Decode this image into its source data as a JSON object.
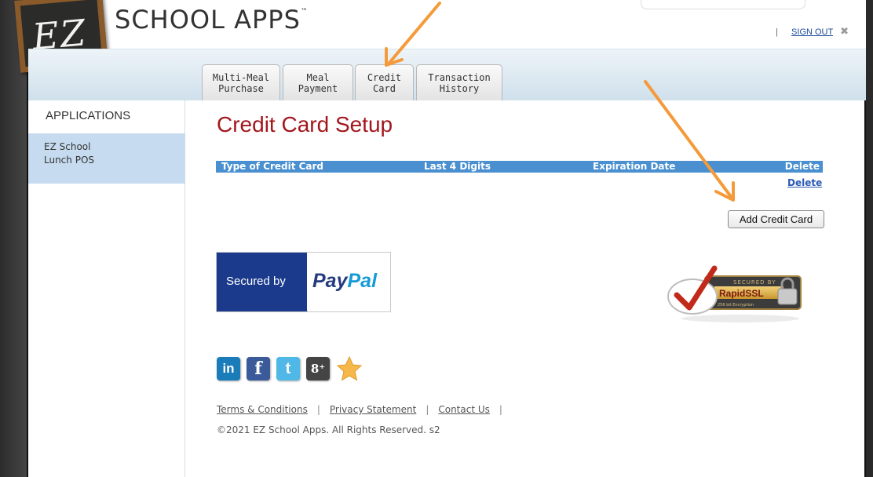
{
  "brand": {
    "logo_text": "EZ",
    "name": "SCHOOL APPS",
    "trademark": "™"
  },
  "header": {
    "separator": "|",
    "sign_out": "SIGN OUT",
    "close_symbol": "✖"
  },
  "tabs": [
    {
      "line1": "Multi-Meal",
      "line2": "Purchase"
    },
    {
      "line1": "Meal",
      "line2": "Payment"
    },
    {
      "line1": "Credit",
      "line2": "Card"
    },
    {
      "line1": "Transaction",
      "line2": "History"
    }
  ],
  "sidebar": {
    "title": "APPLICATIONS",
    "items": [
      {
        "line1": "EZ School",
        "line2": "Lunch POS"
      }
    ]
  },
  "main": {
    "title": "Credit Card Setup",
    "table": {
      "columns": [
        "Type of Credit Card",
        "Last 4 Digits",
        "Expiration Date",
        "Delete"
      ],
      "rows": [
        {
          "delete_link": "Delete"
        }
      ]
    },
    "add_button": "Add Credit Card"
  },
  "badges": {
    "paypal": {
      "secured_by": "Secured by",
      "brand_pay": "Pay",
      "brand_pal": "Pal"
    },
    "ssl": {
      "top_text": "SECURED BY",
      "brand": "RapidSSL",
      "sub": "256 bit Encryption"
    }
  },
  "social": {
    "icons": [
      "linkedin-icon",
      "facebook-icon",
      "twitter-icon",
      "google-plus-icon",
      "star-icon"
    ],
    "glyphs": {
      "linkedin": "in",
      "facebook": "f",
      "twitter": "t",
      "google_plus": "8⁺"
    }
  },
  "footer": {
    "links": [
      "Terms & Conditions",
      "Privacy Statement",
      "Contact Us"
    ],
    "separator": "|",
    "copyright": "©2021 EZ School Apps. All Rights Reserved. s2"
  },
  "colors": {
    "title_red": "#a3161c",
    "table_header_blue": "#4a90d0",
    "sidebar_selected": "#c6dbef",
    "annotation_arrow": "#f59a3a"
  }
}
